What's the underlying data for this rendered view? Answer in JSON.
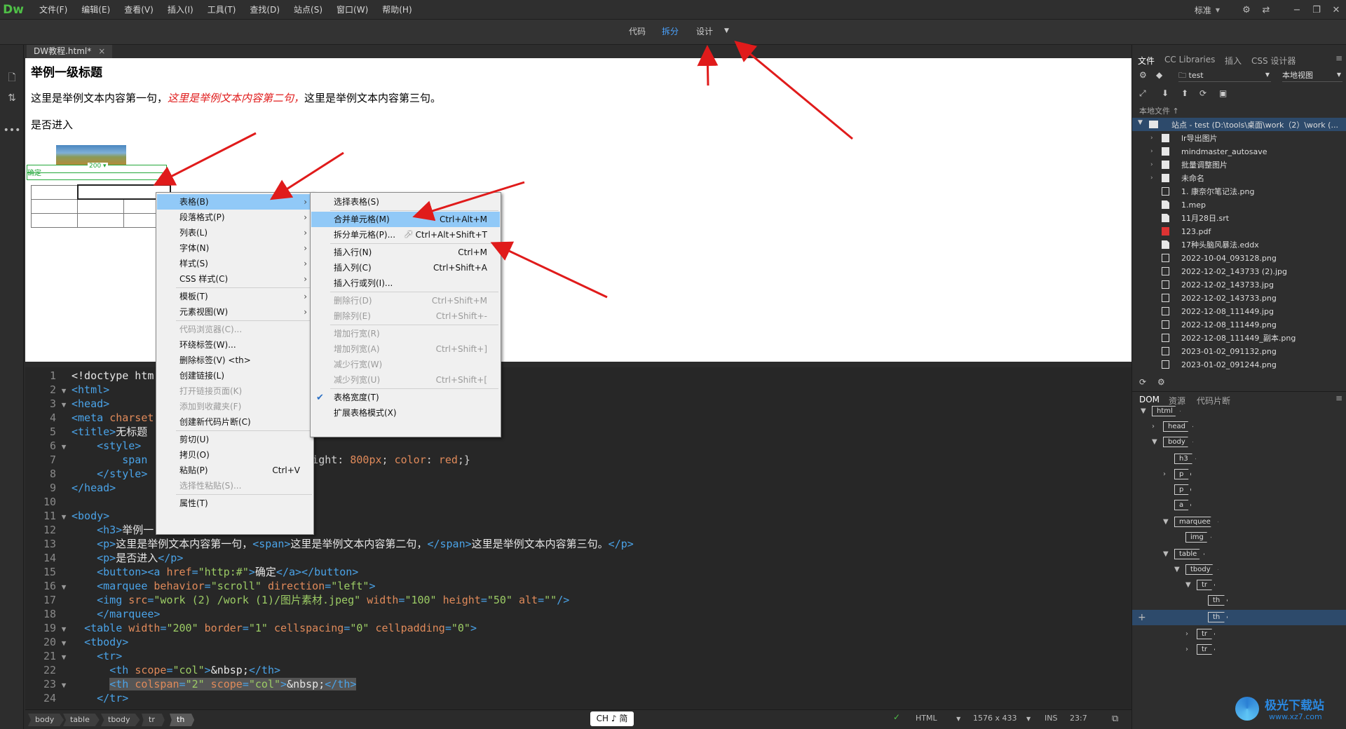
{
  "app": {
    "logo": "Dw"
  },
  "menubar": {
    "items": [
      "文件(F)",
      "编辑(E)",
      "查看(V)",
      "插入(I)",
      "工具(T)",
      "查找(D)",
      "站点(S)",
      "窗口(W)",
      "帮助(H)"
    ],
    "workspace": "标准",
    "gear_icon": "gear-icon"
  },
  "viewbar": {
    "code": "代码",
    "split": "拆分",
    "design": "设计",
    "active": "拆分"
  },
  "doc_tab": {
    "name": "DW教程.html*",
    "close": "×"
  },
  "design": {
    "heading": "举例一级标题",
    "p1_a": "这里是举例文本内容第一句，",
    "p1_red": "这里是举例文本内容第二句，",
    "p1_c": "这里是举例文本内容第三句。",
    "p2": "是否进入",
    "width_badge": "200 ▾",
    "tag_label": "确定"
  },
  "context_menu": {
    "items": [
      {
        "label": "表格(B)",
        "sub": true,
        "highlight": true
      },
      {
        "label": "段落格式(P)",
        "sub": true
      },
      {
        "label": "列表(L)",
        "sub": true
      },
      {
        "label": "字体(N)",
        "sub": true
      },
      {
        "label": "样式(S)",
        "sub": true
      },
      {
        "label": "CSS 样式(C)",
        "sub": true
      },
      {
        "label": "模板(T)",
        "sub": true
      },
      {
        "label": "元素视图(W)",
        "sub": true
      },
      {
        "label": "代码浏览器(C)...",
        "disabled": true
      },
      {
        "label": "环绕标签(W)..."
      },
      {
        "label": "删除标签(V) <th>"
      },
      {
        "label": "创建链接(L)"
      },
      {
        "label": "打开链接页面(K)",
        "disabled": true
      },
      {
        "label": "添加到收藏夹(F)",
        "disabled": true
      },
      {
        "label": "创建新代码片断(C)"
      },
      {
        "label": "剪切(U)"
      },
      {
        "label": "拷贝(O)"
      },
      {
        "label": "粘贴(P)",
        "shortcut": "Ctrl+V"
      },
      {
        "label": "选择性粘贴(S)...",
        "disabled": true
      },
      {
        "label": "属性(T)"
      }
    ]
  },
  "submenu": {
    "items": [
      {
        "label": "选择表格(S)"
      },
      {
        "label": "合并单元格(M)",
        "shortcut": "Ctrl+Alt+M",
        "highlight": true
      },
      {
        "label": "拆分单元格(P)...",
        "shortcut": "Ctrl+Alt+Shift+T"
      },
      {
        "label": "插入行(N)",
        "shortcut": "Ctrl+M"
      },
      {
        "label": "插入列(C)",
        "shortcut": "Ctrl+Shift+A"
      },
      {
        "label": "插入行或列(I)..."
      },
      {
        "label": "删除行(D)",
        "shortcut": "Ctrl+Shift+M",
        "disabled": true
      },
      {
        "label": "删除列(E)",
        "shortcut": "Ctrl+Shift+-",
        "disabled": true
      },
      {
        "label": "增加行宽(R)",
        "disabled": true
      },
      {
        "label": "增加列宽(A)",
        "shortcut": "Ctrl+Shift+]",
        "disabled": true
      },
      {
        "label": "减少行宽(W)",
        "disabled": true
      },
      {
        "label": "减少列宽(U)",
        "shortcut": "Ctrl+Shift+[",
        "disabled": true
      },
      {
        "label": "表格宽度(T)",
        "checked": true
      },
      {
        "label": "扩展表格模式(X)"
      }
    ]
  },
  "code": {
    "lines": [
      {
        "n": "1",
        "f": "",
        "h": "<span class='txt'>&lt;!doctype htm</span>"
      },
      {
        "n": "2",
        "f": "▼",
        "h": "<span class='tag'>&lt;html&gt;</span>"
      },
      {
        "n": "3",
        "f": "▼",
        "h": "<span class='tag'>&lt;head&gt;</span>"
      },
      {
        "n": "4",
        "f": "",
        "h": "<span class='tag'>&lt;meta </span><span class='attr'>charset</span>"
      },
      {
        "n": "5",
        "f": "",
        "h": "<span class='tag'>&lt;title&gt;</span><span class='txt'>无标题</span>"
      },
      {
        "n": "6",
        "f": "▼",
        "h": "    <span class='tag'>&lt;style&gt;</span>"
      },
      {
        "n": "7",
        "f": "",
        "h": "        <span class='tag'>span</span>                       <span class='css'>-weight: </span><span class='attr'>800px</span><span class='css'>; </span><span class='attr'>color</span><span class='css'>: </span><span class='attr'>red</span><span class='css'>;}</span>"
      },
      {
        "n": "8",
        "f": "",
        "h": "    <span class='tag'>&lt;/style&gt;</span>"
      },
      {
        "n": "9",
        "f": "",
        "h": "<span class='tag'>&lt;/head&gt;</span>"
      },
      {
        "n": "10",
        "f": "",
        "h": ""
      },
      {
        "n": "11",
        "f": "▼",
        "h": "<span class='tag'>&lt;body&gt;</span>"
      },
      {
        "n": "12",
        "f": "",
        "h": "    <span class='tag'>&lt;h3&gt;</span><span class='txt'>举例一</span>"
      },
      {
        "n": "13",
        "f": "",
        "h": "    <span class='tag'>&lt;p&gt;</span><span class='txt'>这里是举例文本内容第一句，</span><span class='tag'>&lt;span&gt;</span><span class='txt'>这里是举例文本内容第二句，</span><span class='tag'>&lt;/span&gt;</span><span class='txt'>这里是举例文本内容第三句。</span><span class='tag'>&lt;/p&gt;</span>"
      },
      {
        "n": "14",
        "f": "",
        "h": "    <span class='tag'>&lt;p&gt;</span><span class='txt'>是否进入</span><span class='tag'>&lt;/p&gt;</span>"
      },
      {
        "n": "15",
        "f": "",
        "h": "    <span class='tag'>&lt;button&gt;&lt;a </span><span class='attr'>href</span><span class='tag'>=</span><span class='val'>\"http:#\"</span><span class='tag'>&gt;</span><span class='txt'>确定</span><span class='tag'>&lt;/a&gt;&lt;/button&gt;</span>"
      },
      {
        "n": "16",
        "f": "▼",
        "h": "    <span class='tag'>&lt;marquee </span><span class='attr'>behavior</span><span class='tag'>=</span><span class='val'>\"scroll\"</span><span class='attr'> direction</span><span class='tag'>=</span><span class='val'>\"left\"</span><span class='tag'>&gt;</span>"
      },
      {
        "n": "17",
        "f": "",
        "h": "    <span class='tag'>&lt;img </span><span class='attr'>src</span><span class='tag'>=</span><span class='val'>\"work (2) /work (1)/图片素材.jpeg\"</span><span class='attr'> width</span><span class='tag'>=</span><span class='val'>\"100\"</span><span class='attr'> height</span><span class='tag'>=</span><span class='val'>\"50\"</span><span class='attr'> alt</span><span class='tag'>=</span><span class='val'>\"\"</span><span class='tag'>/&gt;</span>"
      },
      {
        "n": "18",
        "f": "",
        "h": "    <span class='tag'>&lt;/marquee&gt;</span>"
      },
      {
        "n": "19",
        "f": "▼",
        "h": "  <span class='tag'>&lt;table </span><span class='attr'>width</span><span class='tag'>=</span><span class='val'>\"200\"</span><span class='attr'> border</span><span class='tag'>=</span><span class='val'>\"1\"</span><span class='attr'> cellspacing</span><span class='tag'>=</span><span class='val'>\"0\"</span><span class='attr'> cellpadding</span><span class='tag'>=</span><span class='val'>\"0\"</span><span class='tag'>&gt;</span>"
      },
      {
        "n": "20",
        "f": "▼",
        "h": "  <span class='tag'>&lt;tbody&gt;</span>"
      },
      {
        "n": "21",
        "f": "▼",
        "h": "    <span class='tag'>&lt;tr&gt;</span>"
      },
      {
        "n": "22",
        "f": "",
        "h": "      <span class='tag'>&lt;th </span><span class='attr'>scope</span><span class='tag'>=</span><span class='val'>\"col\"</span><span class='tag'>&gt;</span><span class='txt'>&amp;nbsp;</span><span class='tag'>&lt;/th&gt;</span>"
      },
      {
        "n": "23",
        "f": "▼",
        "h": "      <span class='hl'><span class='tag'>&lt;th </span><span class='attr'>colspan</span><span class='tag'>=</span><span class='val'>\"2\"</span><span class='attr'> scope</span><span class='tag'>=</span><span class='val'>\"col\"</span><span class='tag'>&gt;</span><span class='txt'>&amp;nbsp;</span><span class='tag'>&lt;/th&gt;</span></span>"
      },
      {
        "n": "24",
        "f": "",
        "h": "    <span class='tag'>&lt;/tr&gt;</span>"
      }
    ]
  },
  "statusbar": {
    "crumbs": [
      "body",
      "table",
      "tbody",
      "tr",
      "th"
    ],
    "ime": "CH ♪ 简",
    "lang": "HTML",
    "size": "1576 x 433",
    "ins": "INS",
    "pos": "23:7"
  },
  "right_panel": {
    "tabs": [
      "文件",
      "CC Libraries",
      "插入",
      "CSS 设计器"
    ],
    "site": "test",
    "view": "本地视图",
    "local_files": "本地文件 ↑",
    "site_root": "站点 - test (D:\\tools\\桌面\\work（2）\\work (...",
    "files": [
      {
        "name": "lr导出图片",
        "type": "dir"
      },
      {
        "name": "mindmaster_autosave",
        "type": "dir"
      },
      {
        "name": "批量调整图片",
        "type": "dir"
      },
      {
        "name": "未命名",
        "type": "dir"
      },
      {
        "name": "1. 康奈尔笔记法.png",
        "type": "img"
      },
      {
        "name": "1.mep",
        "type": "file"
      },
      {
        "name": "11月28日.srt",
        "type": "file"
      },
      {
        "name": "123.pdf",
        "type": "pdf"
      },
      {
        "name": "17种头脑风暴法.eddx",
        "type": "file"
      },
      {
        "name": "2022-10-04_093128.png",
        "type": "img"
      },
      {
        "name": "2022-12-02_143733 (2).jpg",
        "type": "img"
      },
      {
        "name": "2022-12-02_143733.jpg",
        "type": "img"
      },
      {
        "name": "2022-12-02_143733.png",
        "type": "img"
      },
      {
        "name": "2022-12-08_111449.jpg",
        "type": "img"
      },
      {
        "name": "2022-12-08_111449.png",
        "type": "img"
      },
      {
        "name": "2022-12-08_111449_副本.png",
        "type": "img"
      },
      {
        "name": "2023-01-02_091132.png",
        "type": "img"
      },
      {
        "name": "2023-01-02_091244.png",
        "type": "img"
      }
    ],
    "dom_tabs": [
      "DOM",
      "资源",
      "代码片断"
    ],
    "dom_nodes": [
      "html",
      "head",
      "body",
      "h3",
      "p",
      "p",
      "a",
      "marquee",
      "img",
      "table",
      "tbody",
      "tr",
      "th",
      "th",
      "tr",
      "tr"
    ]
  },
  "watermark": {
    "cn": "极光下载站",
    "url": "www.xz7.com"
  },
  "colors": {
    "accent": "#4aa3ff",
    "annotation_arrow": "#e01b1b",
    "highlight": "#91c9f7"
  }
}
